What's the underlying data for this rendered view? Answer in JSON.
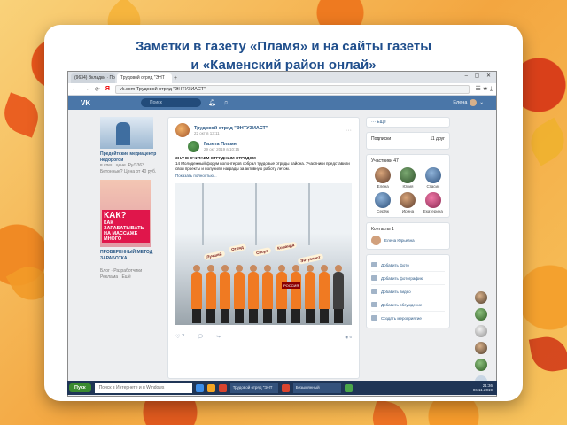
{
  "slide": {
    "title_line1": "Заметки в газету «Пламя» и на сайты газеты",
    "title_line2": "и «Каменский район онлай»"
  },
  "browser": {
    "tabs": [
      "(9634) Вкладки · Почт",
      "Трудовой отряд \"ЭНТ"
    ],
    "new_tab": "+",
    "window_controls": "– ▢ ✕",
    "nav": {
      "back": "←",
      "forward": "→",
      "reload": "⟳",
      "ya": "Я"
    },
    "address": "vk.com  Трудовой отряд \"ЭНТУЗИАСТ\"",
    "menu_icons": "☰  ★  ⤓"
  },
  "vk": {
    "logo": "VK",
    "search_placeholder": "Поиск",
    "user_name": "Елена",
    "left_ads": {
      "ad1_title": "Предейтские медиацентр недорогой",
      "ad1_text": "в спец. цене. Ру/3363 Бетонные? Цена от 40 руб.",
      "ad2_promo": "КАК ЗАРАБАТЫВАТЬ НА МАССАЖЕ МНОГО",
      "ad2_big": "КАК?",
      "ad2_title": "ПРОВЕРЕННЫЙ МЕТОД ЗАРАБОТКА",
      "ad2_text": "Блог · Разработчики · Реклама · Ещё"
    },
    "post": {
      "author": "Трудовой отряд \"ЭНТУЗИАСТ\"",
      "date": "22 окт в 13:11",
      "repost_author": "Газета Пламя",
      "repost_date": "29 окт 2019 в 10:15",
      "text_title": "ЗНАЧЕ СЧИТАЕМ ОТРЯДНЫМ ОТРЯДОМ",
      "text_body": "14 Молодежный форум волонтеров собрал трудовые отряды района. Участники представили свои проекты и получили награды за активную работу летом.",
      "show_more": "Показать полностью...",
      "signs": [
        "Лучший",
        "Отряд",
        "Спорт",
        "Команда",
        "Энтузиаст"
      ],
      "flag_text": "РОССИЯ",
      "like_count": "7",
      "views": "◉ 6"
    },
    "right": {
      "more": "Ещё",
      "subscriptions": {
        "label": "Подписки",
        "count": "11 друг"
      },
      "friends": {
        "label": "Участники",
        "count": "47",
        "items": [
          "Елена",
          "Юлия",
          "Стасис",
          "Серёж",
          "Ирина",
          "Екатерина"
        ]
      },
      "contacts": {
        "label": "Контакты",
        "count": "1",
        "name": "Елена Юрьевна"
      },
      "actions": [
        "Добавить фото",
        "Добавить фотографию",
        "Добавить видео",
        "Добавить обсуждение",
        "Создать мероприятие"
      ]
    }
  },
  "taskbar": {
    "start": "Пуск",
    "search": "Поиск в Интернете и в Windows",
    "apps": [
      "Трудовой отряд \"ЭНТ",
      "Безымянный"
    ],
    "tray_time": "21:36",
    "tray_date": "06.11.2019"
  }
}
